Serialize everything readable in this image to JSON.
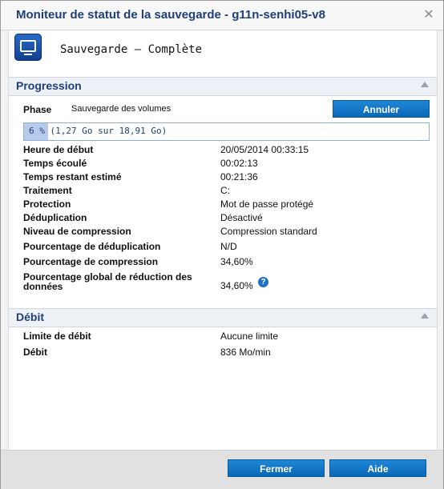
{
  "window": {
    "title": "Moniteur de statut de la sauvegarde - g11n-senhi05-v8",
    "close_icon": "close-icon"
  },
  "header": {
    "status": "Sauvegarde – Complète",
    "icon": "backup-monitor-icon"
  },
  "progression": {
    "section_title": "Progression",
    "phase_label": "Phase",
    "phase_value": "Sauvegarde des volumes",
    "cancel_label": "Annuler",
    "progress_percent": 6,
    "progress_text": "6 % (1,27 Go sur 18,91 Go)",
    "rows": [
      {
        "label": "Heure de début",
        "value": "20/05/2014 00:33:15"
      },
      {
        "label": "Temps écoulé",
        "value": "00:02:13"
      },
      {
        "label": "Temps restant estimé",
        "value": "00:21:36"
      },
      {
        "label": "Traitement",
        "value": "C:"
      },
      {
        "label": "Protection",
        "value": "Mot de passe protégé"
      },
      {
        "label": "Déduplication",
        "value": "Désactivé"
      },
      {
        "label": "Niveau de compression",
        "value": "Compression standard"
      },
      {
        "label": "Pourcentage de déduplication",
        "value": "N/D"
      },
      {
        "label": "Pourcentage de compression",
        "value": "34,60%"
      }
    ],
    "overall_label": "Pourcentage global de réduction des données",
    "overall_value": "34,60%",
    "help_icon": "?"
  },
  "debit": {
    "section_title": "Débit",
    "rows": [
      {
        "label": "Limite de débit",
        "value": "Aucune limite"
      },
      {
        "label": "Débit",
        "value": "836 Mo/min"
      }
    ]
  },
  "footer": {
    "close_label": "Fermer",
    "help_label": "Aide"
  }
}
